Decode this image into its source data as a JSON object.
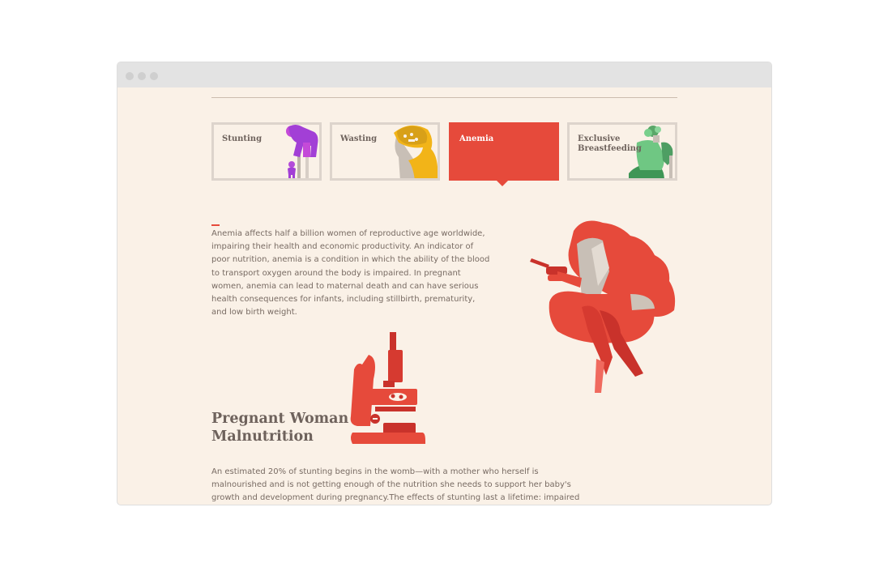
{
  "tabs": [
    {
      "label": "Stunting",
      "icon": "stunting-illustration",
      "active": false
    },
    {
      "label": "Wasting",
      "icon": "wasting-illustration",
      "active": false
    },
    {
      "label": "Anemia",
      "icon": "",
      "active": true
    },
    {
      "label": "Exclusive\nBreastfeeding",
      "icon": "breastfeeding-illustration",
      "active": false
    }
  ],
  "anemia": {
    "description": "Anemia affects half a billion women of reproductive age worldwide, impairing their health and economic productivity. An indicator of poor nutrition, anemia is a condition in which the ability of the blood to transport oxygen around the body is impaired. In pregnant women, anemia can lead to maternal death and can have serious health consequences for infants, including stillbirth, prematurity, and low birth weight.",
    "illustration": "seated-woman-illustration"
  },
  "section": {
    "heading": "Pregnant Woman Malnutrition",
    "illustration": "microscope-illustration",
    "body": "An estimated 20% of stunting begins in the womb—with a mother who herself is malnourished and is not getting enough of the nutrition she needs to support her baby's growth and development during pregnancy.The effects of stunting last a lifetime: impaired brain development, lower IQ, weakened immune"
  },
  "colors": {
    "accent": "#e64a3b",
    "background": "#faf1e7",
    "text": "#786b63",
    "heading": "#6e625c",
    "tab_border": "#ddd4cc"
  }
}
